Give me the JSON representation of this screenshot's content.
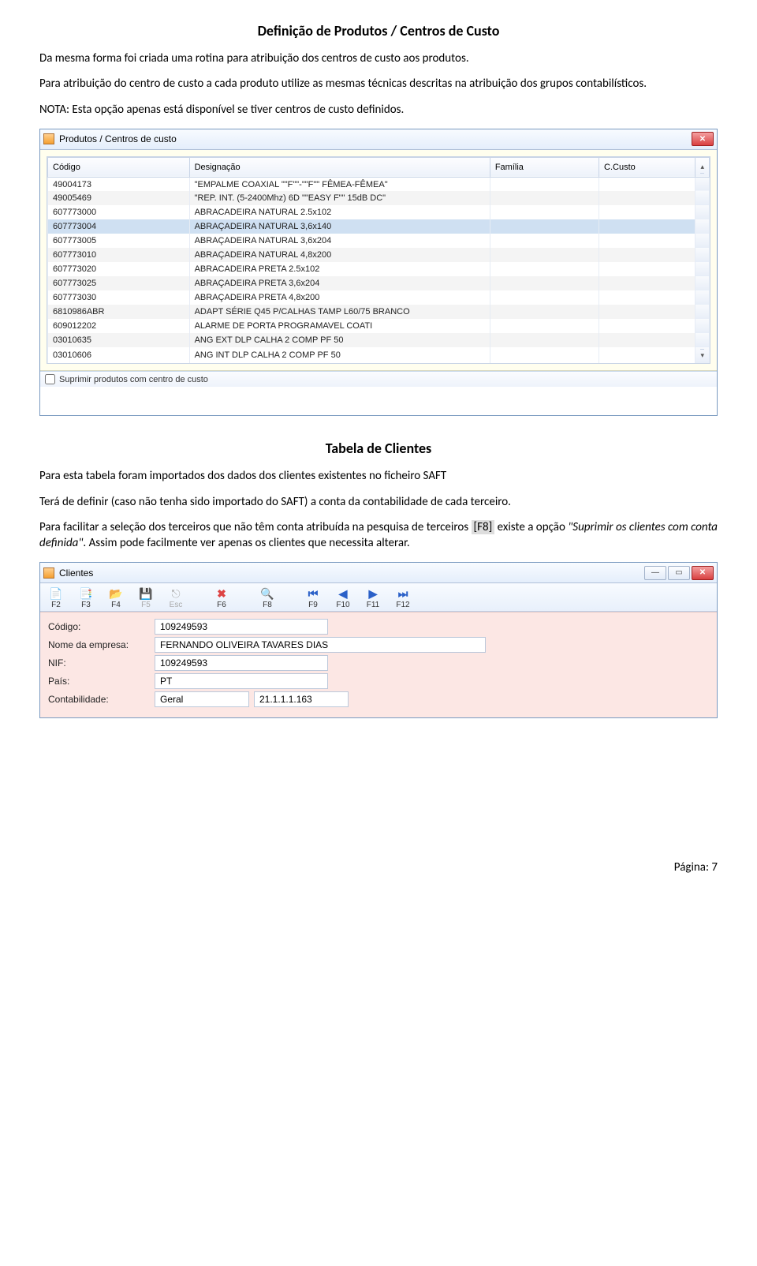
{
  "section1": {
    "title": "Definição de Produtos / Centros de Custo",
    "p1": "Da mesma forma foi criada uma rotina para atribuição dos centros de custo aos produtos.",
    "p2": "Para atribuição do centro de custo a cada produto utilize as mesmas técnicas descritas na atribuição dos grupos contabilísticos.",
    "p3": "NOTA: Esta opção apenas está disponível se tiver centros de custo definidos."
  },
  "win1": {
    "title": "Produtos / Centros de custo",
    "headers": {
      "codigo": "Código",
      "designacao": "Designação",
      "familia": "Família",
      "ccusto": "C.Custo"
    },
    "rows": [
      {
        "codigo": "49004173",
        "desig": "\"EMPALME COAXIAL \"\"F\"\"-\"\"F\"\" FÊMEA-FÊMEA\"",
        "alt": false,
        "sel": false
      },
      {
        "codigo": "49005469",
        "desig": "\"REP. INT. (5-2400Mhz) 6D \"\"EASY F\"\" 15dB DC\"",
        "alt": true,
        "sel": false
      },
      {
        "codigo": "607773000",
        "desig": "ABRACADEIRA NATURAL 2.5x102",
        "alt": false,
        "sel": false
      },
      {
        "codigo": "607773004",
        "desig": "ABRAÇADEIRA NATURAL 3,6x140",
        "alt": true,
        "sel": true
      },
      {
        "codigo": "607773005",
        "desig": "ABRAÇADEIRA NATURAL 3,6x204",
        "alt": false,
        "sel": false
      },
      {
        "codigo": "607773010",
        "desig": "ABRAÇADEIRA NATURAL 4,8x200",
        "alt": true,
        "sel": false
      },
      {
        "codigo": "607773020",
        "desig": "ABRACADEIRA PRETA 2.5x102",
        "alt": false,
        "sel": false
      },
      {
        "codigo": "607773025",
        "desig": "ABRAÇADEIRA PRETA 3,6x204",
        "alt": true,
        "sel": false
      },
      {
        "codigo": "607773030",
        "desig": "ABRAÇADEIRA PRETA 4,8x200",
        "alt": false,
        "sel": false
      },
      {
        "codigo": "6810986ABR",
        "desig": "ADAPT SÉRIE Q45 P/CALHAS TAMP L60/75 BRANCO",
        "alt": true,
        "sel": false
      },
      {
        "codigo": "609012202",
        "desig": "ALARME DE PORTA PROGRAMAVEL COATI",
        "alt": false,
        "sel": false
      },
      {
        "codigo": "03010635",
        "desig": "ANG EXT DLP CALHA 2 COMP PF 50",
        "alt": true,
        "sel": false
      },
      {
        "codigo": "03010606",
        "desig": "ANG INT DLP CALHA 2 COMP PF 50",
        "alt": false,
        "sel": false
      }
    ],
    "footer_checkbox": "Suprimir produtos com centro de custo"
  },
  "section2": {
    "title": "Tabela de Clientes",
    "p1": "Para esta tabela foram importados dos dados dos clientes existentes no ficheiro SAFT",
    "p2": "Terá de definir (caso não tenha sido importado do SAFT) a conta da contabilidade de cada terceiro.",
    "p3a": "Para facilitar a seleção dos terceiros que não têm conta atribuída na pesquisa de terceiros ",
    "p3_key": "[F8]",
    "p3b": " existe a opção ",
    "p3_opt": "\"Suprimir os clientes com conta definida\"",
    "p3c": ". Assim pode facilmente ver apenas os clientes que necessita alterar."
  },
  "win2": {
    "title": "Clientes",
    "toolbar": {
      "f2": "F2",
      "f3": "F3",
      "f4": "F4",
      "f5": "F5",
      "esc": "Esc",
      "f6": "F6",
      "f8": "F8",
      "f9": "F9",
      "f10": "F10",
      "f11": "F11",
      "f12": "F12"
    },
    "labels": {
      "codigo": "Código:",
      "nome": "Nome da empresa:",
      "nif": "NIF:",
      "pais": "País:",
      "contab": "Contabilidade:"
    },
    "values": {
      "codigo": "109249593",
      "nome": "FERNANDO OLIVEIRA TAVARES DIAS",
      "nif": "109249593",
      "pais": "PT",
      "contab_a": "Geral",
      "contab_b": "21.1.1.1.163"
    }
  },
  "footer": "Página: 7"
}
